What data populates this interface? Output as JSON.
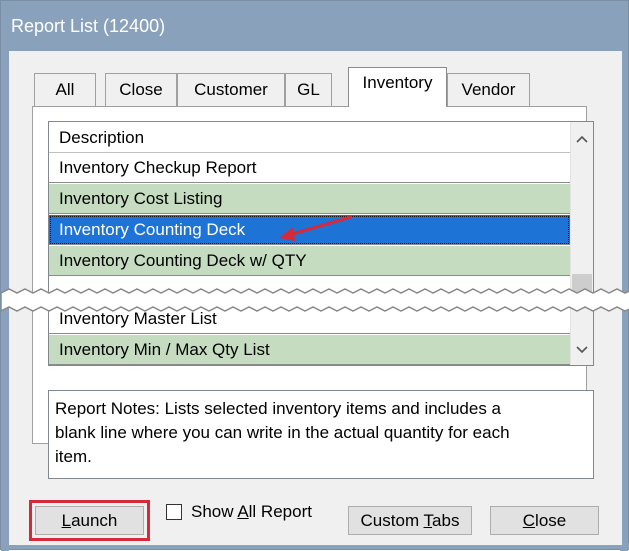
{
  "window": {
    "title": "Report List (12400)"
  },
  "tabs": [
    {
      "label": "All"
    },
    {
      "label": "Close"
    },
    {
      "label": "Customer"
    },
    {
      "label": "GL"
    },
    {
      "label": "Inventory",
      "active": true
    },
    {
      "label": "Vendor"
    }
  ],
  "list": {
    "header": "Description",
    "rows": [
      {
        "label": "Inventory Checkup Report"
      },
      {
        "label": "Inventory Cost Listing"
      },
      {
        "label": "Inventory Counting Deck",
        "selected": true
      },
      {
        "label": "Inventory Counting Deck w/ QTY"
      },
      {
        "label": "Inventory Master List"
      },
      {
        "label": "Inventory Min / Max Qty List"
      }
    ]
  },
  "notes": {
    "line1": "Report Notes:  Lists selected inventory items and includes a",
    "line2": "blank line where you can write in the actual quantity for each",
    "line3": "item."
  },
  "buttons": {
    "launch_first": "L",
    "launch_rest": "aunch",
    "show_all_pre": "Show ",
    "show_all_u": "A",
    "show_all_post": "ll Report",
    "custom_pre": "Custom ",
    "custom_u": "T",
    "custom_post": "abs",
    "close_u": "C",
    "close_post": "lose"
  },
  "colors": {
    "titlebar": "#8aa1bc",
    "row_green": "#c5dcc1",
    "selection": "#1e73d6",
    "highlight_outline": "#d42a3a",
    "arrow": "#d42a3a"
  },
  "icons": {
    "scroll_up": "chevron-up-icon",
    "scroll_down": "chevron-down-icon",
    "annotation": "arrow-icon"
  }
}
